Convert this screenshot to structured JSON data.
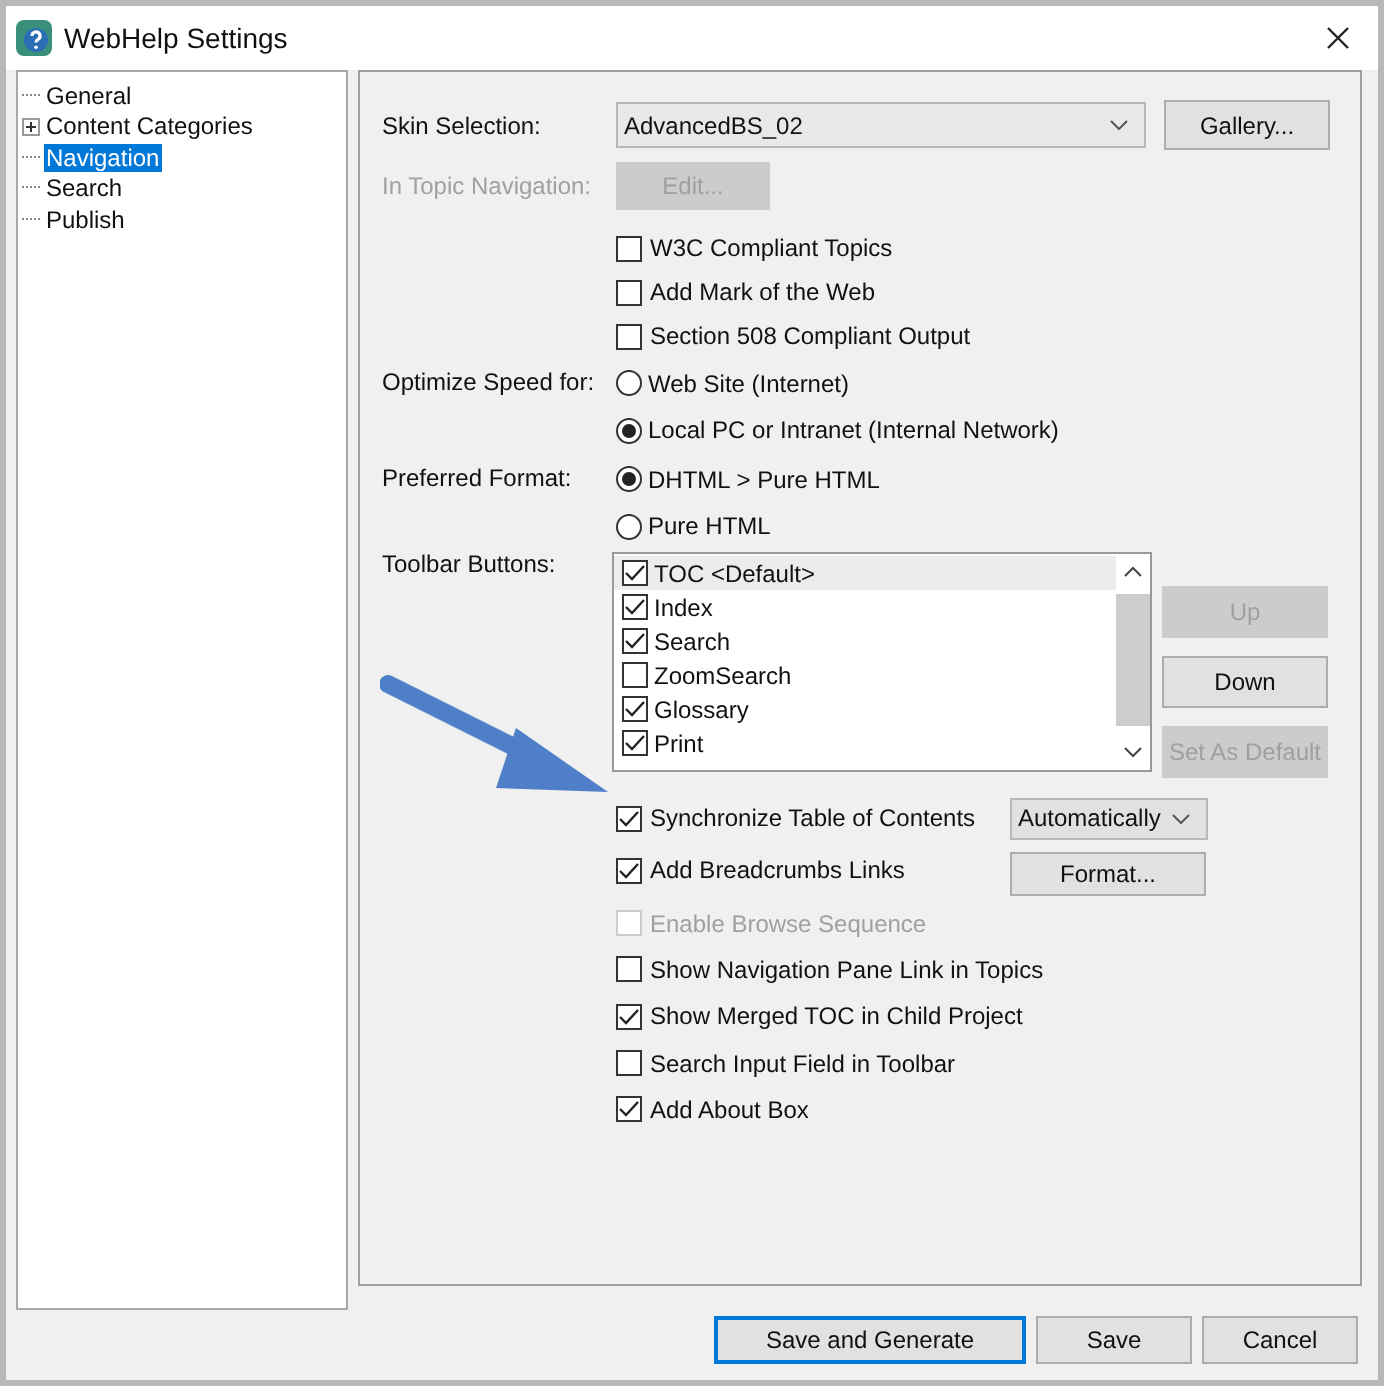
{
  "window": {
    "title": "WebHelp Settings"
  },
  "tree": [
    {
      "label": "General",
      "kind": "leaf",
      "selected": false
    },
    {
      "label": "Content Categories",
      "kind": "collapsed",
      "selected": false
    },
    {
      "label": "Navigation",
      "kind": "leaf",
      "selected": true
    },
    {
      "label": "Search",
      "kind": "leaf",
      "selected": false
    },
    {
      "label": "Publish",
      "kind": "leaf",
      "selected": false
    }
  ],
  "skin": {
    "label": "Skin Selection:",
    "value": "AdvancedBS_02",
    "button": "Gallery..."
  },
  "in_topic": {
    "label": "In Topic Navigation:",
    "button": "Edit...",
    "disabled": true
  },
  "options_top": [
    {
      "label": "W3C Compliant Topics",
      "checked": false
    },
    {
      "label": "Add Mark of the Web",
      "checked": false
    },
    {
      "label": "Section 508 Compliant Output",
      "checked": false
    }
  ],
  "optimize": {
    "label": "Optimize Speed for:",
    "options": [
      {
        "label": "Web Site (Internet)",
        "selected": false
      },
      {
        "label": "Local PC or Intranet (Internal Network)",
        "selected": true
      }
    ]
  },
  "format": {
    "label": "Preferred Format:",
    "options": [
      {
        "label": "DHTML > Pure HTML",
        "selected": true
      },
      {
        "label": "Pure HTML",
        "selected": false
      }
    ]
  },
  "toolbar": {
    "label": "Toolbar Buttons:",
    "items": [
      {
        "label": "TOC <Default>",
        "checked": true,
        "selected": true
      },
      {
        "label": "Index",
        "checked": true,
        "selected": false
      },
      {
        "label": "Search",
        "checked": true,
        "selected": false
      },
      {
        "label": "ZoomSearch",
        "checked": false,
        "selected": false
      },
      {
        "label": "Glossary",
        "checked": true,
        "selected": false
      },
      {
        "label": "Print",
        "checked": true,
        "selected": false
      }
    ],
    "buttons": [
      {
        "label": "Up",
        "disabled": true
      },
      {
        "label": "Down",
        "disabled": false
      },
      {
        "label": "Set As Default",
        "disabled": true
      }
    ]
  },
  "sync": {
    "label": "Synchronize Table of Contents",
    "checked": true,
    "value": "Automatically"
  },
  "breadcrumbs": {
    "label": "Add Breadcrumbs Links",
    "checked": true,
    "button": "Format..."
  },
  "options_bottom": [
    {
      "label": "Enable Browse Sequence",
      "checked": false,
      "disabled": true
    },
    {
      "label": "Show Navigation Pane Link in Topics",
      "checked": false,
      "disabled": false
    },
    {
      "label": "Show Merged TOC in Child Project",
      "checked": true,
      "disabled": false
    },
    {
      "label": "Search Input Field in Toolbar",
      "checked": false,
      "disabled": false
    },
    {
      "label": "Add About Box",
      "checked": true,
      "disabled": false
    }
  ],
  "footer": [
    {
      "label": "Save and Generate",
      "default": true
    },
    {
      "label": "Save",
      "default": false
    },
    {
      "label": "Cancel",
      "default": false
    }
  ]
}
